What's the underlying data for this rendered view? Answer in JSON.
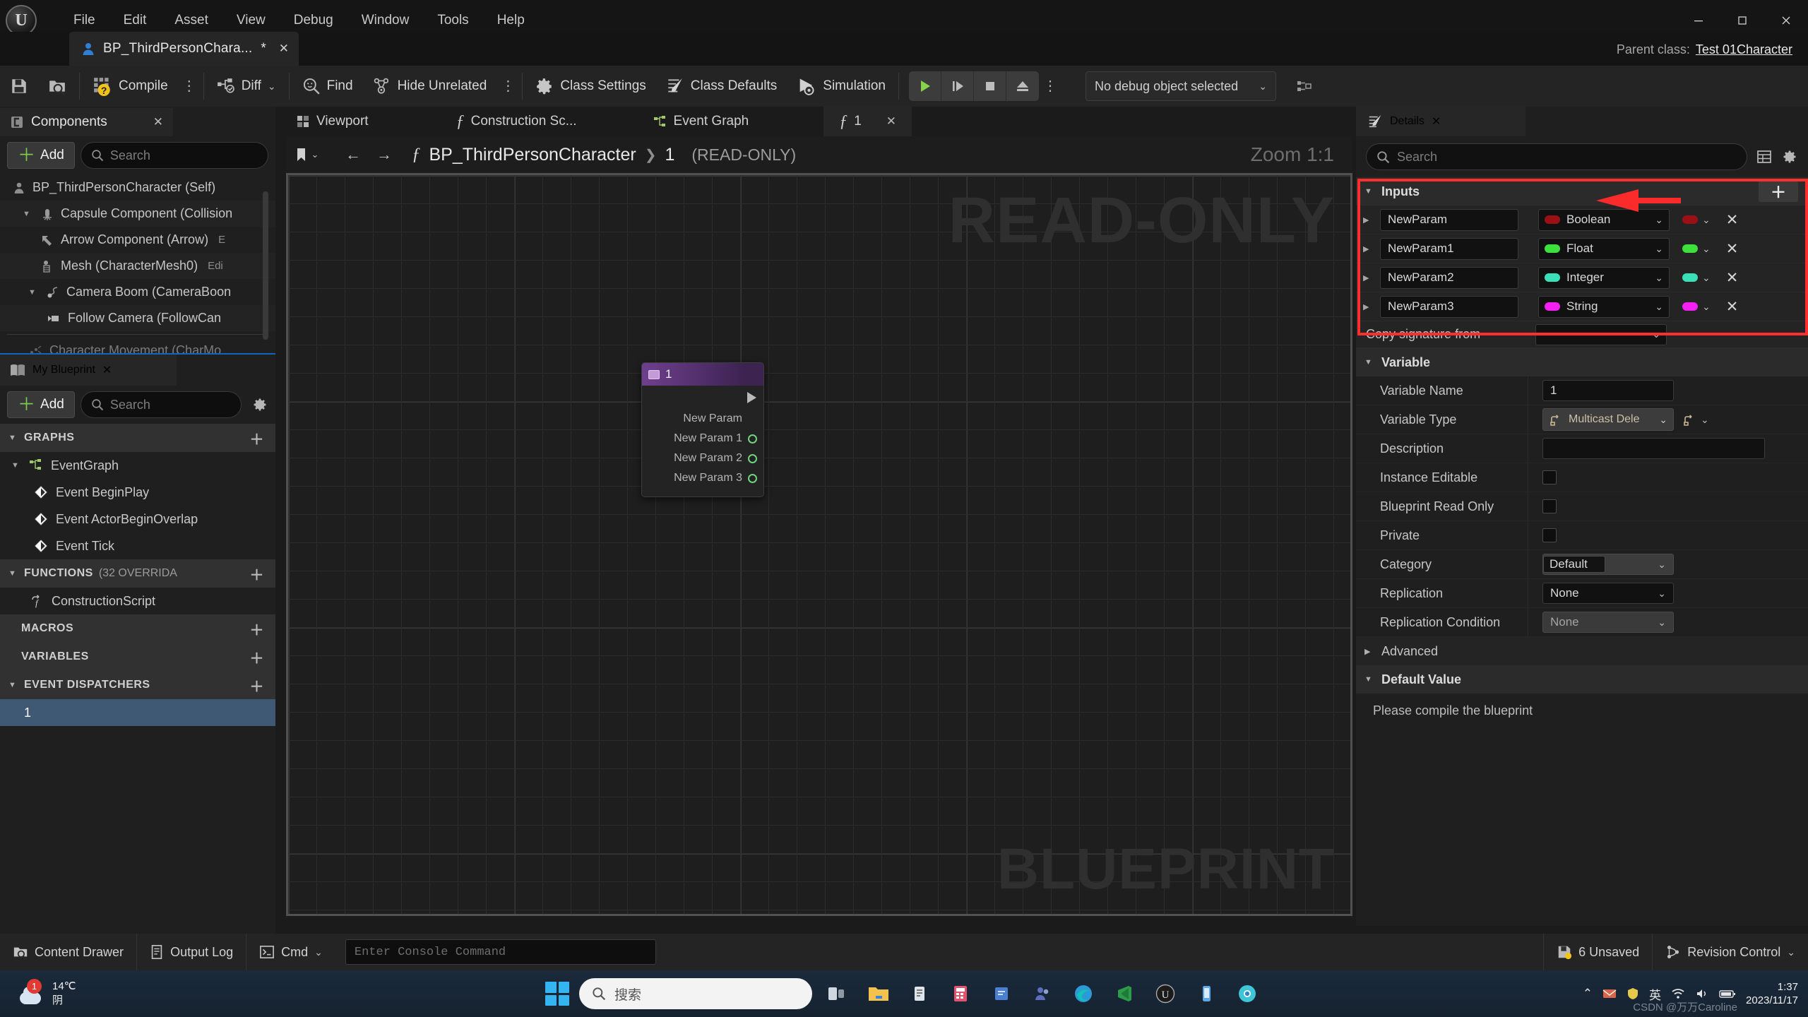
{
  "titlebar": {
    "logo": "unreal-logo",
    "menu": [
      "File",
      "Edit",
      "Asset",
      "View",
      "Debug",
      "Window",
      "Tools",
      "Help"
    ],
    "window_controls": {
      "minimize": "—",
      "maximize": "❐",
      "close": "✕"
    }
  },
  "asset_tab": {
    "icon": "character-blueprint-icon",
    "label": "BP_ThirdPersonChara...",
    "dirty_marker": "*",
    "close": "✕"
  },
  "parent_class": {
    "label": "Parent class:",
    "value": "Test 01Character"
  },
  "toolbar": {
    "save_icon": "save-icon",
    "browse_icon": "browse-content-icon",
    "compile_label": "Compile",
    "compile_status_icon": "compile-question-icon",
    "diff_label": "Diff",
    "find_label": "Find",
    "hide_unrelated_label": "Hide Unrelated",
    "class_settings_label": "Class Settings",
    "class_defaults_label": "Class Defaults",
    "simulation_label": "Simulation",
    "play_icon": "play-icon",
    "step_icon": "step-icon",
    "stop_icon": "stop-icon",
    "eject_icon": "eject-icon",
    "kebab": "⋮",
    "debug_object": "No debug object selected",
    "debug_extra_icon": "debug-filter-icon"
  },
  "components_panel": {
    "title": "Components",
    "close": "✕",
    "add_label": "Add",
    "search_placeholder": "Search",
    "tree": [
      {
        "label": "BP_ThirdPersonCharacter (Self)",
        "icon": "character-icon",
        "indent": 0,
        "twisty": ""
      },
      {
        "label": "Capsule Component (Collision",
        "icon": "capsule-icon",
        "indent": 1,
        "twisty": "▼"
      },
      {
        "label": "Arrow Component (Arrow)",
        "suffix": "E",
        "icon": "arrow-icon",
        "indent": 2,
        "twisty": ""
      },
      {
        "label": "Mesh (CharacterMesh0)",
        "suffix": "Edi",
        "icon": "mesh-icon",
        "indent": 2,
        "twisty": ""
      },
      {
        "label": "Camera Boom (CameraBoon",
        "icon": "spring-arm-icon",
        "indent": 2,
        "twisty": "▼"
      },
      {
        "label": "Follow Camera (FollowCan",
        "icon": "camera-icon",
        "indent": 3,
        "twisty": ""
      },
      {
        "label": "Character Movement (CharMo",
        "icon": "movement-icon",
        "indent": 1,
        "twisty": ""
      }
    ]
  },
  "my_blueprint_panel": {
    "title": "My Blueprint",
    "close": "✕",
    "add_label": "Add",
    "search_placeholder": "Search",
    "settings_icon": "gear-icon",
    "sections": [
      {
        "name": "GRAPHS",
        "twisty": "▼",
        "add": "＋",
        "items": [
          {
            "label": "EventGraph",
            "icon": "eventgraph-icon",
            "indent": 0,
            "twisty": "▼",
            "selected": false
          },
          {
            "label": "Event BeginPlay",
            "icon": "event-node-icon",
            "indent": 1,
            "twisty": "",
            "selected": false
          },
          {
            "label": "Event ActorBeginOverlap",
            "icon": "event-node-icon",
            "indent": 1,
            "twisty": "",
            "selected": false
          },
          {
            "label": "Event Tick",
            "icon": "event-node-icon",
            "indent": 1,
            "twisty": "",
            "selected": false
          }
        ]
      },
      {
        "name": "FUNCTIONS",
        "extra": "(32 OVERRIDA",
        "twisty": "▼",
        "add": "＋",
        "items": [
          {
            "label": "ConstructionScript",
            "icon": "function-icon",
            "indent": 1,
            "twisty": "",
            "selected": false
          }
        ]
      },
      {
        "name": "MACROS",
        "twisty": "",
        "add": "＋",
        "items": []
      },
      {
        "name": "VARIABLES",
        "twisty": "",
        "add": "＋",
        "items": []
      },
      {
        "name": "EVENT DISPATCHERS",
        "twisty": "▼",
        "add": "＋",
        "items": [
          {
            "label": "1",
            "icon": "",
            "indent": 1,
            "twisty": "",
            "selected": true
          }
        ]
      }
    ]
  },
  "graph_tabs": [
    {
      "label": "Viewport",
      "icon": "viewport-icon",
      "active": false,
      "closable": false
    },
    {
      "label": "Construction Sc...",
      "icon": "construction-icon",
      "active": false,
      "closable": false
    },
    {
      "label": "Event Graph",
      "icon": "eventgraph-icon",
      "active": false,
      "closable": false
    },
    {
      "label": "1",
      "icon": "function-f-icon",
      "active": true,
      "closable": true,
      "close": "✕"
    }
  ],
  "graph": {
    "nav_back": "←",
    "nav_forward": "→",
    "bookmark_icon": "bookmark-icon",
    "breadcrumb_f": "ƒ",
    "breadcrumb_main": "BP_ThirdPersonCharacter",
    "breadcrumb_sep": "❯",
    "breadcrumb_sub": "1",
    "readonly_tag": "(READ-ONLY)",
    "zoom_label": "Zoom 1:1",
    "watermark_readonly": "READ-ONLY",
    "watermark_blueprint": "BLUEPRINT",
    "node": {
      "title": "1",
      "icon": "event-dispatcher-node-icon",
      "pins": [
        "New Param",
        "New Param 1",
        "New Param 2",
        "New Param 3"
      ]
    }
  },
  "details_panel": {
    "title": "Details",
    "close": "✕",
    "search_placeholder": "Search",
    "grid_icon": "grid-view-icon",
    "settings_icon": "gear-icon",
    "inputs": {
      "header": "Inputs",
      "twisty": "▼",
      "add_button": "＋",
      "params": [
        {
          "name": "NewParam",
          "type": "Boolean",
          "color": "#9b1016",
          "twisty": "▶",
          "delete": "✕"
        },
        {
          "name": "NewParam1",
          "type": "Float",
          "color": "#3ee03e",
          "twisty": "▶",
          "delete": "✕"
        },
        {
          "name": "NewParam2",
          "type": "Integer",
          "color": "#3ae0b7",
          "twisty": "▶",
          "delete": "✕"
        },
        {
          "name": "NewParam3",
          "type": "String",
          "color": "#f31ff3",
          "twisty": "▶",
          "delete": "✕"
        }
      ],
      "copy_signature_label": "Copy signature from"
    },
    "variable": {
      "header": "Variable",
      "twisty": "▼",
      "rows": [
        {
          "label": "Variable Name",
          "kind": "input",
          "value": "1"
        },
        {
          "label": "Variable Type",
          "kind": "dropdown",
          "value": "Multicast Dele",
          "icon": "multicast-delegate-icon"
        },
        {
          "label": "Description",
          "kind": "input-wide",
          "value": ""
        },
        {
          "label": "Instance Editable",
          "kind": "checkbox",
          "value": ""
        },
        {
          "label": "Blueprint Read Only",
          "kind": "checkbox",
          "value": ""
        },
        {
          "label": "Private",
          "kind": "checkbox",
          "value": ""
        },
        {
          "label": "Category",
          "kind": "select-inner",
          "value": "Default"
        },
        {
          "label": "Replication",
          "kind": "select",
          "value": "None"
        },
        {
          "label": "Replication Condition",
          "kind": "select-muted",
          "value": "None"
        }
      ],
      "advanced": {
        "label": "Advanced",
        "twisty": "▶"
      }
    },
    "default_value": {
      "header": "Default Value",
      "twisty": "▼",
      "note": "Please compile the blueprint"
    }
  },
  "statusbar": {
    "content_drawer": "Content Drawer",
    "output_log": "Output Log",
    "cmd_label": "Cmd",
    "console_placeholder": "Enter Console Command",
    "unsaved": "6 Unsaved",
    "revision_control": "Revision Control"
  },
  "taskbar": {
    "weather_temp": "14℃",
    "weather_desc": "阴",
    "weather_badge": "1",
    "search_placeholder": "搜索",
    "clock_time": "1:37",
    "clock_date": "2023/11/17",
    "watermark": "CSDN @万万Caroline",
    "apps": [
      "task-view-icon",
      "file-explorer-icon",
      "store-icon",
      "calculator-icon",
      "editor-icon",
      "teams-icon",
      "edge-icon",
      "vscode-icon",
      "unreal-icon",
      "phonelink-icon",
      "chrome-icon"
    ],
    "tray": [
      "chevron-up-icon",
      "mail-icon",
      "shield-icon",
      "ime-icon",
      "wifi-icon",
      "volume-icon",
      "battery-icon"
    ]
  },
  "colors": {
    "accent_green": "#7ec850",
    "highlight_red": "#ff2f2f",
    "selection_blue": "#3f5874",
    "panel_bg": "#1f1f1f",
    "tab_active": "#262626"
  }
}
